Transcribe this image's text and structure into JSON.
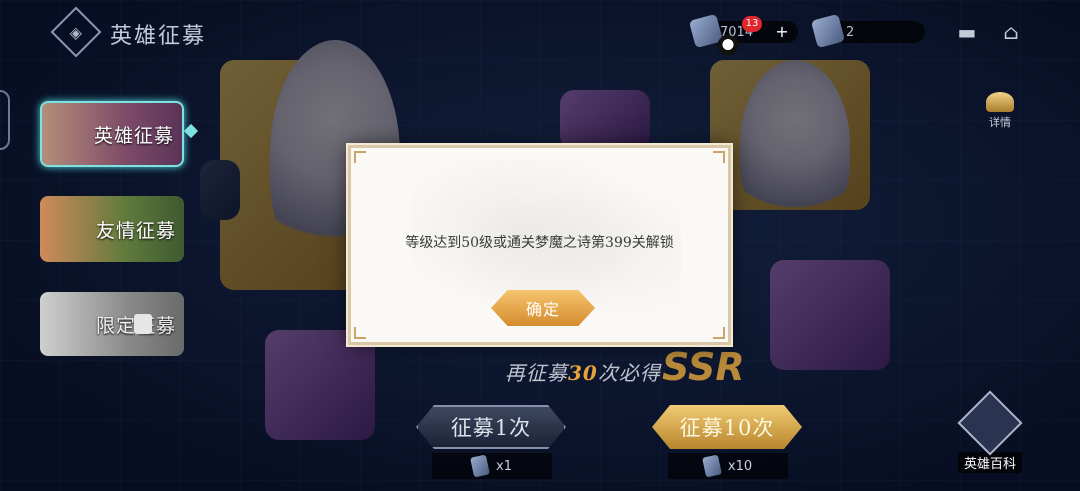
{
  "header": {
    "title": "英雄征募",
    "gem_count": "7014",
    "notification_count": "13",
    "ticket_count": "2"
  },
  "sidebar": {
    "items": [
      {
        "label": "英雄征募",
        "active": true
      },
      {
        "label": "友情征募",
        "active": false
      },
      {
        "label": "限定征募",
        "locked": true
      }
    ]
  },
  "right_panel": {
    "detail_label": "详情",
    "encyclopedia_label": "英雄百科"
  },
  "banner": {
    "pity_prefix": "再征募",
    "pity_count": "30",
    "pity_suffix": "次必得",
    "rarity": "SSR"
  },
  "actions": {
    "recruit_once_label": "征募1次",
    "recruit_ten_label": "征募10次",
    "cost_once": "x1",
    "cost_ten": "x10"
  },
  "modal": {
    "message": "等级达到50级或通关梦魔之诗第399关解锁",
    "confirm_label": "确定"
  },
  "colors": {
    "accent_gold": "#d58c2e",
    "active_border": "#7ee3e0",
    "badge_red": "#e1262c"
  }
}
